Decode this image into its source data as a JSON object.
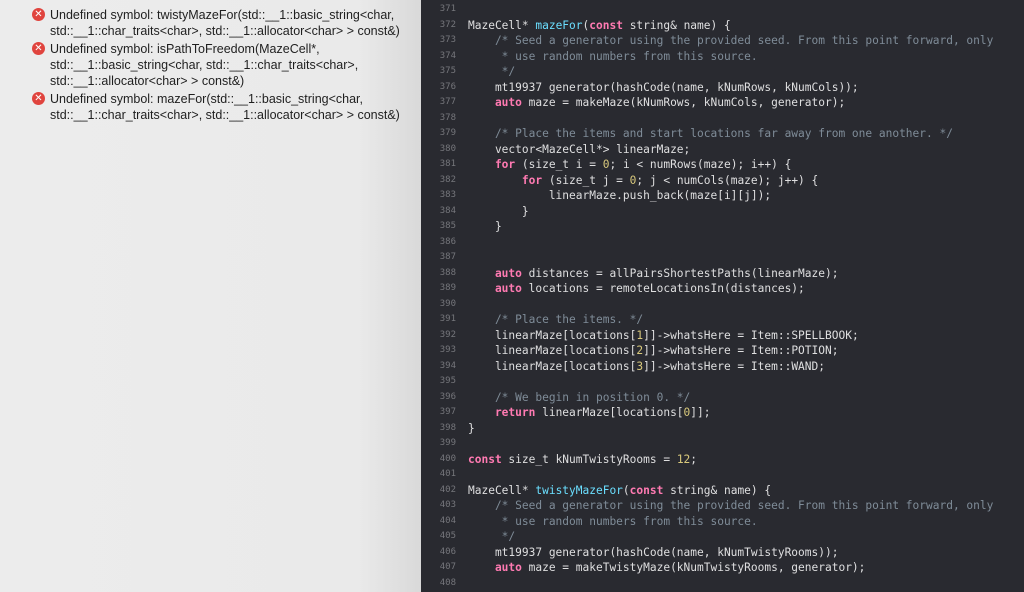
{
  "issues": [
    {
      "icon": "error-icon",
      "lines": [
        "Undefined symbol: twistyMazeFor(std::__1::basic_string<char,",
        "std::__1::char_traits<char>, std::__1::allocator<char> > const&)"
      ]
    },
    {
      "icon": "error-icon",
      "lines": [
        "Undefined symbol: isPathToFreedom(MazeCell*,",
        "std::__1::basic_string<char, std::__1::char_traits<char>,",
        "std::__1::allocator<char> > const&)"
      ]
    },
    {
      "icon": "error-icon",
      "lines": [
        "Undefined symbol: mazeFor(std::__1::basic_string<char,",
        "std::__1::char_traits<char>, std::__1::allocator<char> > const&)"
      ]
    }
  ],
  "colors": {
    "editor_bg": "#292a30",
    "keyword": "#ff7ab2",
    "function_decl": "#6bdfff",
    "comment": "#7f8c98",
    "number": "#d9c97c",
    "plain": "#dfdfe0",
    "line_number": "#75767b",
    "error": "#e0443e"
  },
  "code_lines": [
    {
      "n": "371",
      "segs": []
    },
    {
      "n": "372",
      "segs": [
        [
          "ty",
          "MazeCell* "
        ],
        [
          "fn",
          "mazeFor"
        ],
        [
          "ty",
          "("
        ],
        [
          "kw",
          "const"
        ],
        [
          "ty",
          " string& name) {"
        ]
      ]
    },
    {
      "n": "373",
      "segs": [
        [
          "cm",
          "    /* Seed a generator using the provided seed. From this point forward, only"
        ]
      ]
    },
    {
      "n": "374",
      "segs": [
        [
          "cm",
          "     * use random numbers from this source."
        ]
      ]
    },
    {
      "n": "375",
      "segs": [
        [
          "cm",
          "     */"
        ]
      ]
    },
    {
      "n": "376",
      "segs": [
        [
          "ty",
          "    mt19937 generator(hashCode(name, kNumRows, kNumCols));"
        ]
      ]
    },
    {
      "n": "377",
      "segs": [
        [
          "kw",
          "    auto"
        ],
        [
          "ty",
          " maze = makeMaze(kNumRows, kNumCols, generator);"
        ]
      ]
    },
    {
      "n": "378",
      "segs": []
    },
    {
      "n": "379",
      "segs": [
        [
          "cm",
          "    /* Place the items and start locations far away from one another. */"
        ]
      ]
    },
    {
      "n": "380",
      "segs": [
        [
          "ty",
          "    vector<MazeCell*> linearMaze;"
        ]
      ]
    },
    {
      "n": "381",
      "segs": [
        [
          "kw",
          "    for"
        ],
        [
          "ty",
          " (size_t i = "
        ],
        [
          "nm",
          "0"
        ],
        [
          "ty",
          "; i < numRows(maze); i++) {"
        ]
      ]
    },
    {
      "n": "382",
      "segs": [
        [
          "kw",
          "        for"
        ],
        [
          "ty",
          " (size_t j = "
        ],
        [
          "nm",
          "0"
        ],
        [
          "ty",
          "; j < numCols(maze); j++) {"
        ]
      ]
    },
    {
      "n": "383",
      "segs": [
        [
          "ty",
          "            linearMaze.push_back(maze[i][j]);"
        ]
      ]
    },
    {
      "n": "384",
      "segs": [
        [
          "ty",
          "        }"
        ]
      ]
    },
    {
      "n": "385",
      "segs": [
        [
          "ty",
          "    }"
        ]
      ]
    },
    {
      "n": "386",
      "segs": []
    },
    {
      "n": "387",
      "segs": []
    },
    {
      "n": "388",
      "segs": [
        [
          "kw",
          "    auto"
        ],
        [
          "ty",
          " distances = allPairsShortestPaths(linearMaze);"
        ]
      ]
    },
    {
      "n": "389",
      "segs": [
        [
          "kw",
          "    auto"
        ],
        [
          "ty",
          " locations = remoteLocationsIn(distances);"
        ]
      ]
    },
    {
      "n": "390",
      "segs": []
    },
    {
      "n": "391",
      "segs": [
        [
          "cm",
          "    /* Place the items. */"
        ]
      ]
    },
    {
      "n": "392",
      "segs": [
        [
          "ty",
          "    linearMaze[locations["
        ],
        [
          "nm",
          "1"
        ],
        [
          "ty",
          "]]->whatsHere = Item::SPELLBOOK;"
        ]
      ]
    },
    {
      "n": "393",
      "segs": [
        [
          "ty",
          "    linearMaze[locations["
        ],
        [
          "nm",
          "2"
        ],
        [
          "ty",
          "]]->whatsHere = Item::POTION;"
        ]
      ]
    },
    {
      "n": "394",
      "segs": [
        [
          "ty",
          "    linearMaze[locations["
        ],
        [
          "nm",
          "3"
        ],
        [
          "ty",
          "]]->whatsHere = Item::WAND;"
        ]
      ]
    },
    {
      "n": "395",
      "segs": []
    },
    {
      "n": "396",
      "segs": [
        [
          "cm",
          "    /* We begin in position 0. */"
        ]
      ]
    },
    {
      "n": "397",
      "segs": [
        [
          "kw",
          "    return"
        ],
        [
          "ty",
          " linearMaze[locations["
        ],
        [
          "nm",
          "0"
        ],
        [
          "ty",
          "]];"
        ]
      ]
    },
    {
      "n": "398",
      "segs": [
        [
          "ty",
          "}"
        ]
      ]
    },
    {
      "n": "399",
      "segs": []
    },
    {
      "n": "400",
      "segs": [
        [
          "kw",
          "const"
        ],
        [
          "ty",
          " size_t kNumTwistyRooms = "
        ],
        [
          "nm",
          "12"
        ],
        [
          "ty",
          ";"
        ]
      ]
    },
    {
      "n": "401",
      "segs": []
    },
    {
      "n": "402",
      "segs": [
        [
          "ty",
          "MazeCell* "
        ],
        [
          "fn",
          "twistyMazeFor"
        ],
        [
          "ty",
          "("
        ],
        [
          "kw",
          "const"
        ],
        [
          "ty",
          " string& name) {"
        ]
      ]
    },
    {
      "n": "403",
      "segs": [
        [
          "cm",
          "    /* Seed a generator using the provided seed. From this point forward, only"
        ]
      ]
    },
    {
      "n": "404",
      "segs": [
        [
          "cm",
          "     * use random numbers from this source."
        ]
      ]
    },
    {
      "n": "405",
      "segs": [
        [
          "cm",
          "     */"
        ]
      ]
    },
    {
      "n": "406",
      "segs": [
        [
          "ty",
          "    mt19937 generator(hashCode(name, kNumTwistyRooms));"
        ]
      ]
    },
    {
      "n": "407",
      "segs": [
        [
          "kw",
          "    auto"
        ],
        [
          "ty",
          " maze = makeTwistyMaze(kNumTwistyRooms, generator);"
        ]
      ]
    },
    {
      "n": "408",
      "segs": []
    }
  ]
}
